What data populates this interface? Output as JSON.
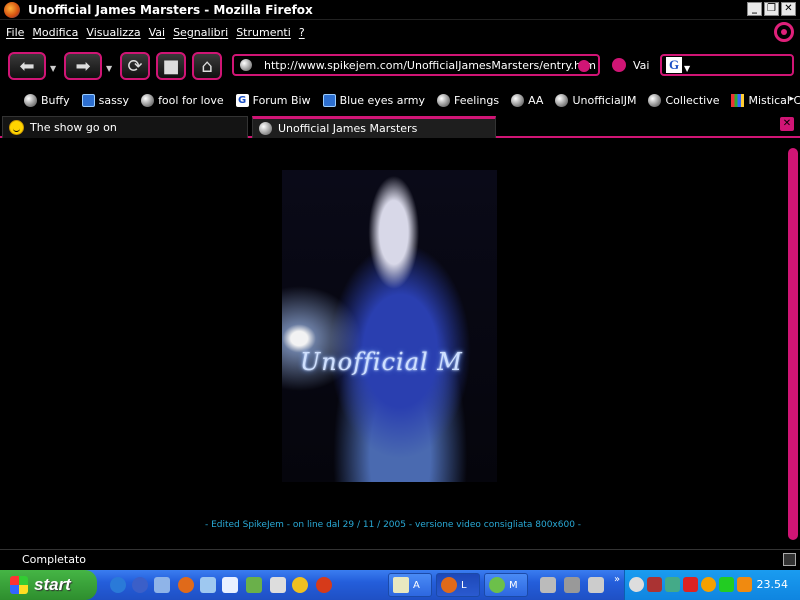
{
  "window": {
    "title": "Unofficial James Marsters - Mozilla Firefox",
    "buttons": [
      "_",
      "❐",
      "✕"
    ]
  },
  "menu": {
    "items": [
      "File",
      "Modifica",
      "Visualizza",
      "Vai",
      "Segnalibri",
      "Strumenti",
      "?"
    ]
  },
  "nav": {
    "url": "http://www.spikejem.com/UnofficialJamesMarsters/entry.htm",
    "go_label": "Vai",
    "search_engine_glyph": "G"
  },
  "bookmarks": {
    "items": [
      {
        "label": "Buffy",
        "icon": "globe-icon"
      },
      {
        "label": "sassy",
        "icon": "blue-square-icon"
      },
      {
        "label": "fool for love",
        "icon": "globe-icon"
      },
      {
        "label": "Forum Biw",
        "icon": "google-icon"
      },
      {
        "label": "Blue eyes army",
        "icon": "blue-square-icon"
      },
      {
        "label": "Feelings",
        "icon": "globe-icon"
      },
      {
        "label": "AA",
        "icon": "globe-icon"
      },
      {
        "label": "UnofficialJM",
        "icon": "globe-icon"
      },
      {
        "label": "Collective",
        "icon": "globe-icon"
      },
      {
        "label": "Mistical CH",
        "icon": "bars-icon"
      }
    ],
    "more_glyph": "▸"
  },
  "tabs": [
    {
      "label": "The show go on",
      "icon": "smiley-icon",
      "active": false
    },
    {
      "label": "Unofficial James Marsters",
      "icon": "globe-icon",
      "active": true
    }
  ],
  "content": {
    "logo_text": "Unofficial M",
    "caption": "- Edited SpikeJem - on line dal 29 / 11 / 2005 - versione video consigliata 800x600 -"
  },
  "status": {
    "text": "Completato"
  },
  "taskbar": {
    "start_label": "start",
    "tasks": [
      "A",
      "L",
      "M"
    ],
    "clock": "23.54",
    "expand_glyph": "»"
  },
  "colors": {
    "accent": "#d01575",
    "caption": "#29a9d6",
    "background": "#000000"
  }
}
